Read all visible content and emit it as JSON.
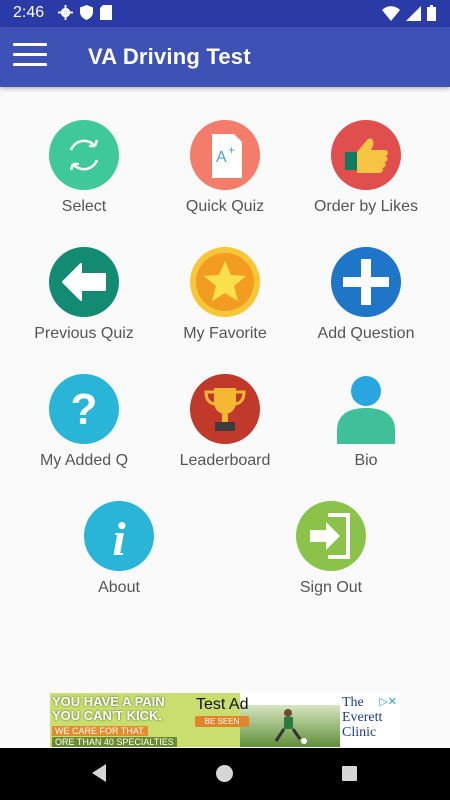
{
  "status_bar": {
    "time": "2:46"
  },
  "app_bar": {
    "title": "VA Driving Test"
  },
  "menu": {
    "select": "Select",
    "quick_quiz": "Quick Quiz",
    "order_by_likes": "Order by Likes",
    "previous_quiz": "Previous Quiz",
    "my_favorite": "My Favorite",
    "add_question": "Add Question",
    "my_added_q": "My Added Q",
    "leaderboard": "Leaderboard",
    "bio": "Bio",
    "about": "About",
    "sign_out": "Sign Out"
  },
  "ad": {
    "headline_1": "YOU HAVE A PAIN",
    "headline_2": "YOU CAN'T KICK.",
    "subline": "WE CARE FOR THAT.",
    "specialties": "ORE THAN 40 SPECIALTIES",
    "cta": "BE SEEN",
    "test_label": "Test Ad",
    "brand_line_1": "The",
    "brand_line_2": "Everett",
    "brand_line_3": "Clinic"
  },
  "colors": {
    "status_bar": "#2a3aa6",
    "app_bar": "#3e51b5",
    "background": "#fafafa"
  }
}
